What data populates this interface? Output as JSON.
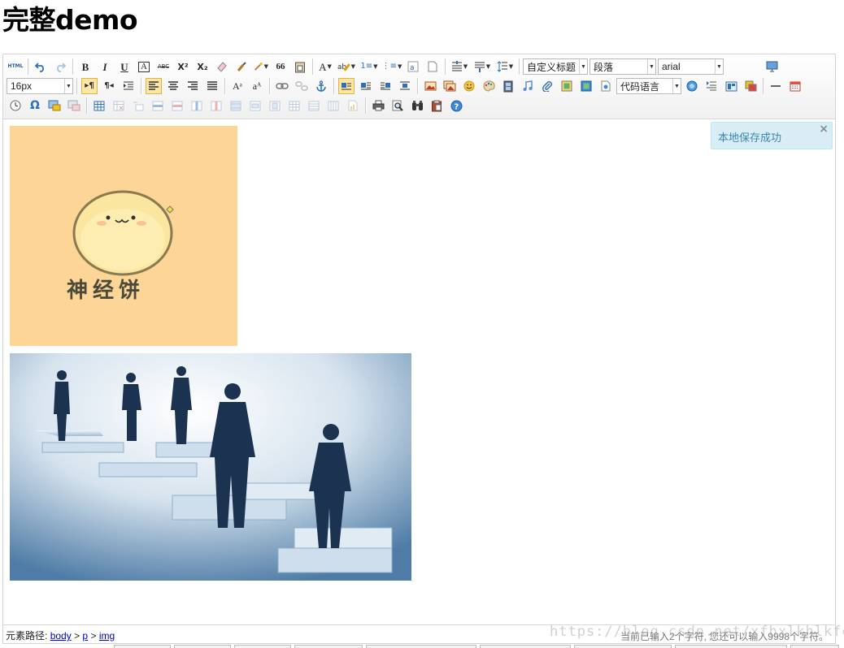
{
  "page": {
    "title": "完整demo"
  },
  "toolbar": {
    "combos": {
      "heading": "自定义标题",
      "paragraph": "段落",
      "font_family": "arial",
      "font_size": "16px",
      "code_language": "代码语言"
    },
    "labels": {
      "html": "HTML",
      "bold": "B",
      "italic": "I",
      "underline": "U",
      "font_border": "A",
      "strike": "ABC",
      "sup": "X²",
      "sub": "X₂",
      "quote": "66",
      "forecolor": "A",
      "ordered": "1≡",
      "unordered": "⋮≡",
      "ltr": "▸¶",
      "rtl": "¶◂",
      "omega": "Ω"
    }
  },
  "toast": {
    "message": "本地保存成功",
    "close": "×"
  },
  "images": [
    {
      "caption": "神经饼",
      "bg": "#fdd596"
    },
    {
      "bg": "#dde6ee"
    }
  ],
  "statusbar": {
    "path_label": "元素路径:",
    "path": [
      "body",
      "p",
      "img"
    ],
    "sep": ">",
    "wordcount": "当前已输入2个字符, 您还可以输入9998个字符。"
  },
  "watermark": "https://blog.csdn.net/xfhxlkhlkfe",
  "colors": {
    "accent_active": "#fbe6a6",
    "toast_bg": "#d9edf7",
    "toast_text": "#3a87ad",
    "link": "#0000cc"
  }
}
